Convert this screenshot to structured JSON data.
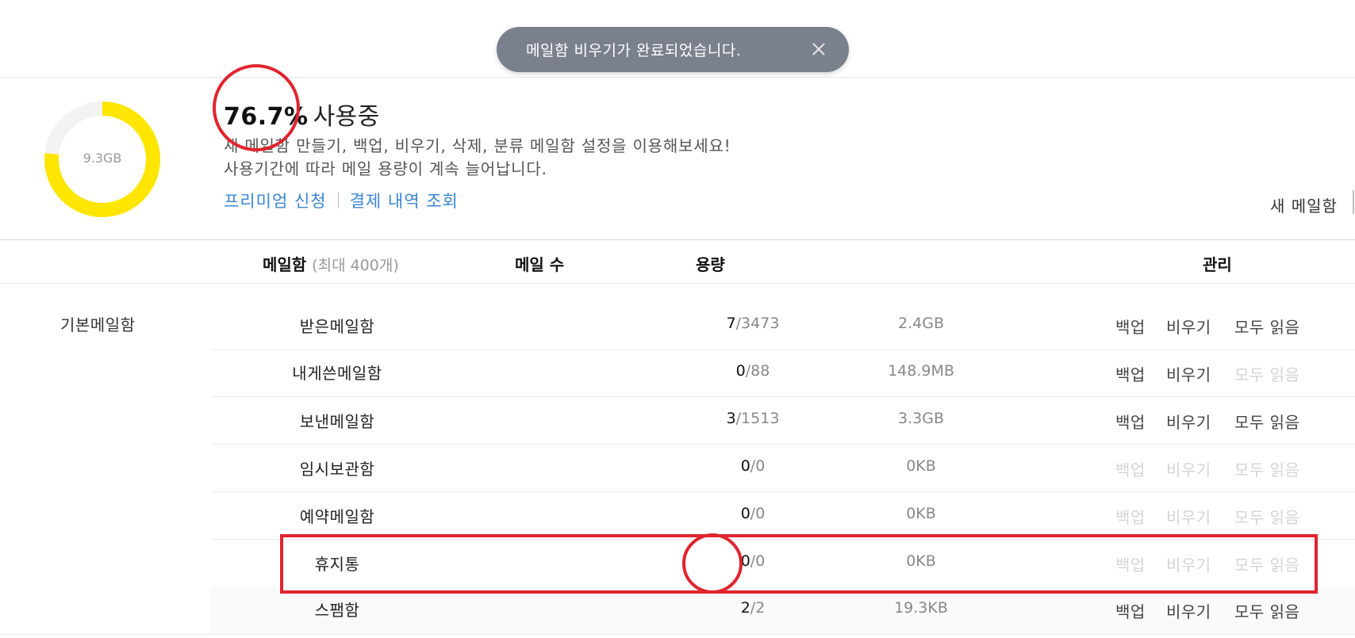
{
  "toast": {
    "message": "메일함 비우기가 완료되었습니다.",
    "close_icon": "close-icon"
  },
  "usage": {
    "total": "9.3GB",
    "percent": "76.7%",
    "percent_value": 76.7,
    "using_label": "사용중",
    "desc1": "새 메일함 만들기, 백업, 비우기, 삭제, 분류 메일함 설정을 이용해보세요!",
    "desc2": "사용기간에 따라 메일 용량이 계속 늘어납니다.",
    "links": {
      "premium": "프리미엄 신청",
      "payment": "결제 내역 조회"
    },
    "colors": {
      "used": "#ffe600",
      "free": "#f3f3f3"
    }
  },
  "new_mailbox_label": "새 메일함",
  "table": {
    "headers": {
      "mailbox": "메일함",
      "mailbox_note": "(최대 400개)",
      "count": "메일 수",
      "size": "용량",
      "manage": "관리"
    },
    "group_label": "기본메일함",
    "actions": {
      "backup": "백업",
      "empty": "비우기",
      "read_all": "모두 읽음"
    },
    "rows": [
      {
        "name": "받은메일함",
        "unread": "7",
        "total": "/3473",
        "size": "2.4GB"
      },
      {
        "name": "내게쓴메일함",
        "unread": "0",
        "total": "/88",
        "size": "148.9MB"
      },
      {
        "name": "보낸메일함",
        "unread": "3",
        "total": "/1513",
        "size": "3.3GB"
      },
      {
        "name": "임시보관함",
        "unread": "0",
        "total": "/0",
        "size": "0KB"
      },
      {
        "name": "예약메일함",
        "unread": "0",
        "total": "/0",
        "size": "0KB"
      },
      {
        "name": "휴지통",
        "unread": "0",
        "total": "/0",
        "size": "0KB"
      },
      {
        "name": "스팸함",
        "unread": "2",
        "total": "/2",
        "size": "19.3KB"
      }
    ]
  },
  "annotation_color": "#e0242e"
}
